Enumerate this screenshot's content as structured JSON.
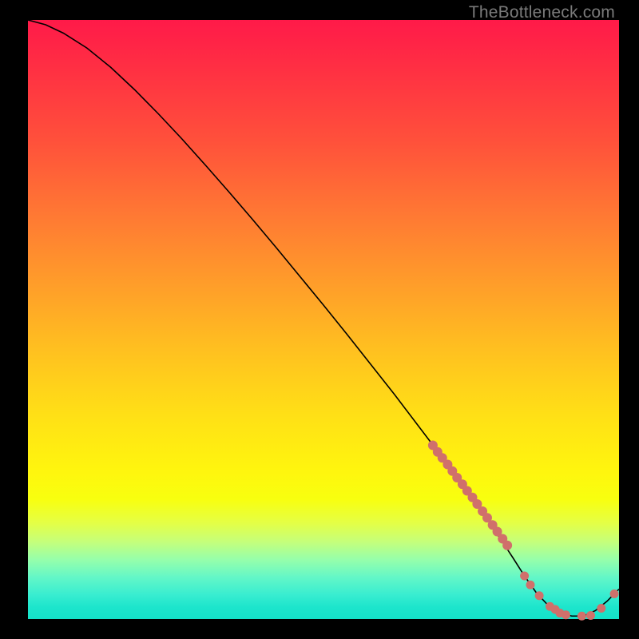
{
  "watermark": "TheBottleneck.com",
  "chart_data": {
    "type": "line",
    "title": "",
    "xlabel": "",
    "ylabel": "",
    "xlim": [
      0,
      100
    ],
    "ylim": [
      0,
      100
    ],
    "series": [
      {
        "name": "curve",
        "color": "#000000",
        "x": [
          0,
          3,
          6,
          10,
          14,
          18,
          22,
          26,
          30,
          34,
          38,
          42,
          46,
          50,
          54,
          58,
          62,
          66,
          70,
          74,
          78,
          80,
          82,
          84,
          86,
          88,
          90,
          92,
          94,
          96,
          98,
          100
        ],
        "y": [
          100,
          99.2,
          97.8,
          95.3,
          92.1,
          88.4,
          84.4,
          80.2,
          75.8,
          71.3,
          66.7,
          62.0,
          57.2,
          52.4,
          47.5,
          42.5,
          37.5,
          32.3,
          27.1,
          21.7,
          16.2,
          13.3,
          10.3,
          7.2,
          4.4,
          2.3,
          1.0,
          0.5,
          0.5,
          1.4,
          3.0,
          5.0
        ]
      }
    ],
    "dots": {
      "color": "#d0706b",
      "radius_px": 6,
      "cluster_segment": {
        "x": [
          68.5,
          69.3,
          70.1,
          71.0,
          71.8,
          72.6,
          73.5,
          74.3,
          75.2,
          76.0,
          76.9,
          77.7,
          78.6,
          79.4,
          80.3,
          81.1
        ],
        "y": [
          29.0,
          27.9,
          26.9,
          25.8,
          24.7,
          23.6,
          22.5,
          21.4,
          20.3,
          19.2,
          18.0,
          16.9,
          15.7,
          14.6,
          13.4,
          12.3
        ]
      },
      "cluster_bottom": {
        "x": [
          84.0,
          85.0,
          86.5,
          88.3,
          89.2,
          90.0,
          91.0,
          93.7,
          95.2,
          97.0
        ],
        "y": [
          7.2,
          5.7,
          3.9,
          2.1,
          1.6,
          1.0,
          0.7,
          0.5,
          0.6,
          1.8
        ]
      },
      "extra_dot": {
        "x": 99.2,
        "y": 4.2
      }
    }
  }
}
